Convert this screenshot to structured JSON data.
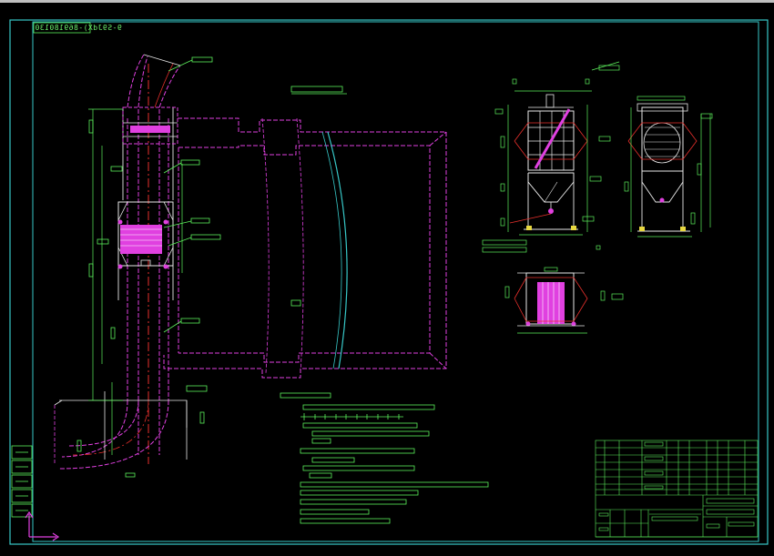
{
  "drawing": {
    "corner_stamp": "9-S9JdX)-869180130",
    "background": "#000000",
    "colors": {
      "frame": "#37c8c8",
      "annotation": "#5cf05c",
      "duct": "#e040e0",
      "outline": "#e8e8e8",
      "axis_x": "#e040e0",
      "axis_y": "#e040e0"
    },
    "title_block_icon": "table-grid-icon",
    "ucs_icon": "ucs-axes-icon"
  }
}
